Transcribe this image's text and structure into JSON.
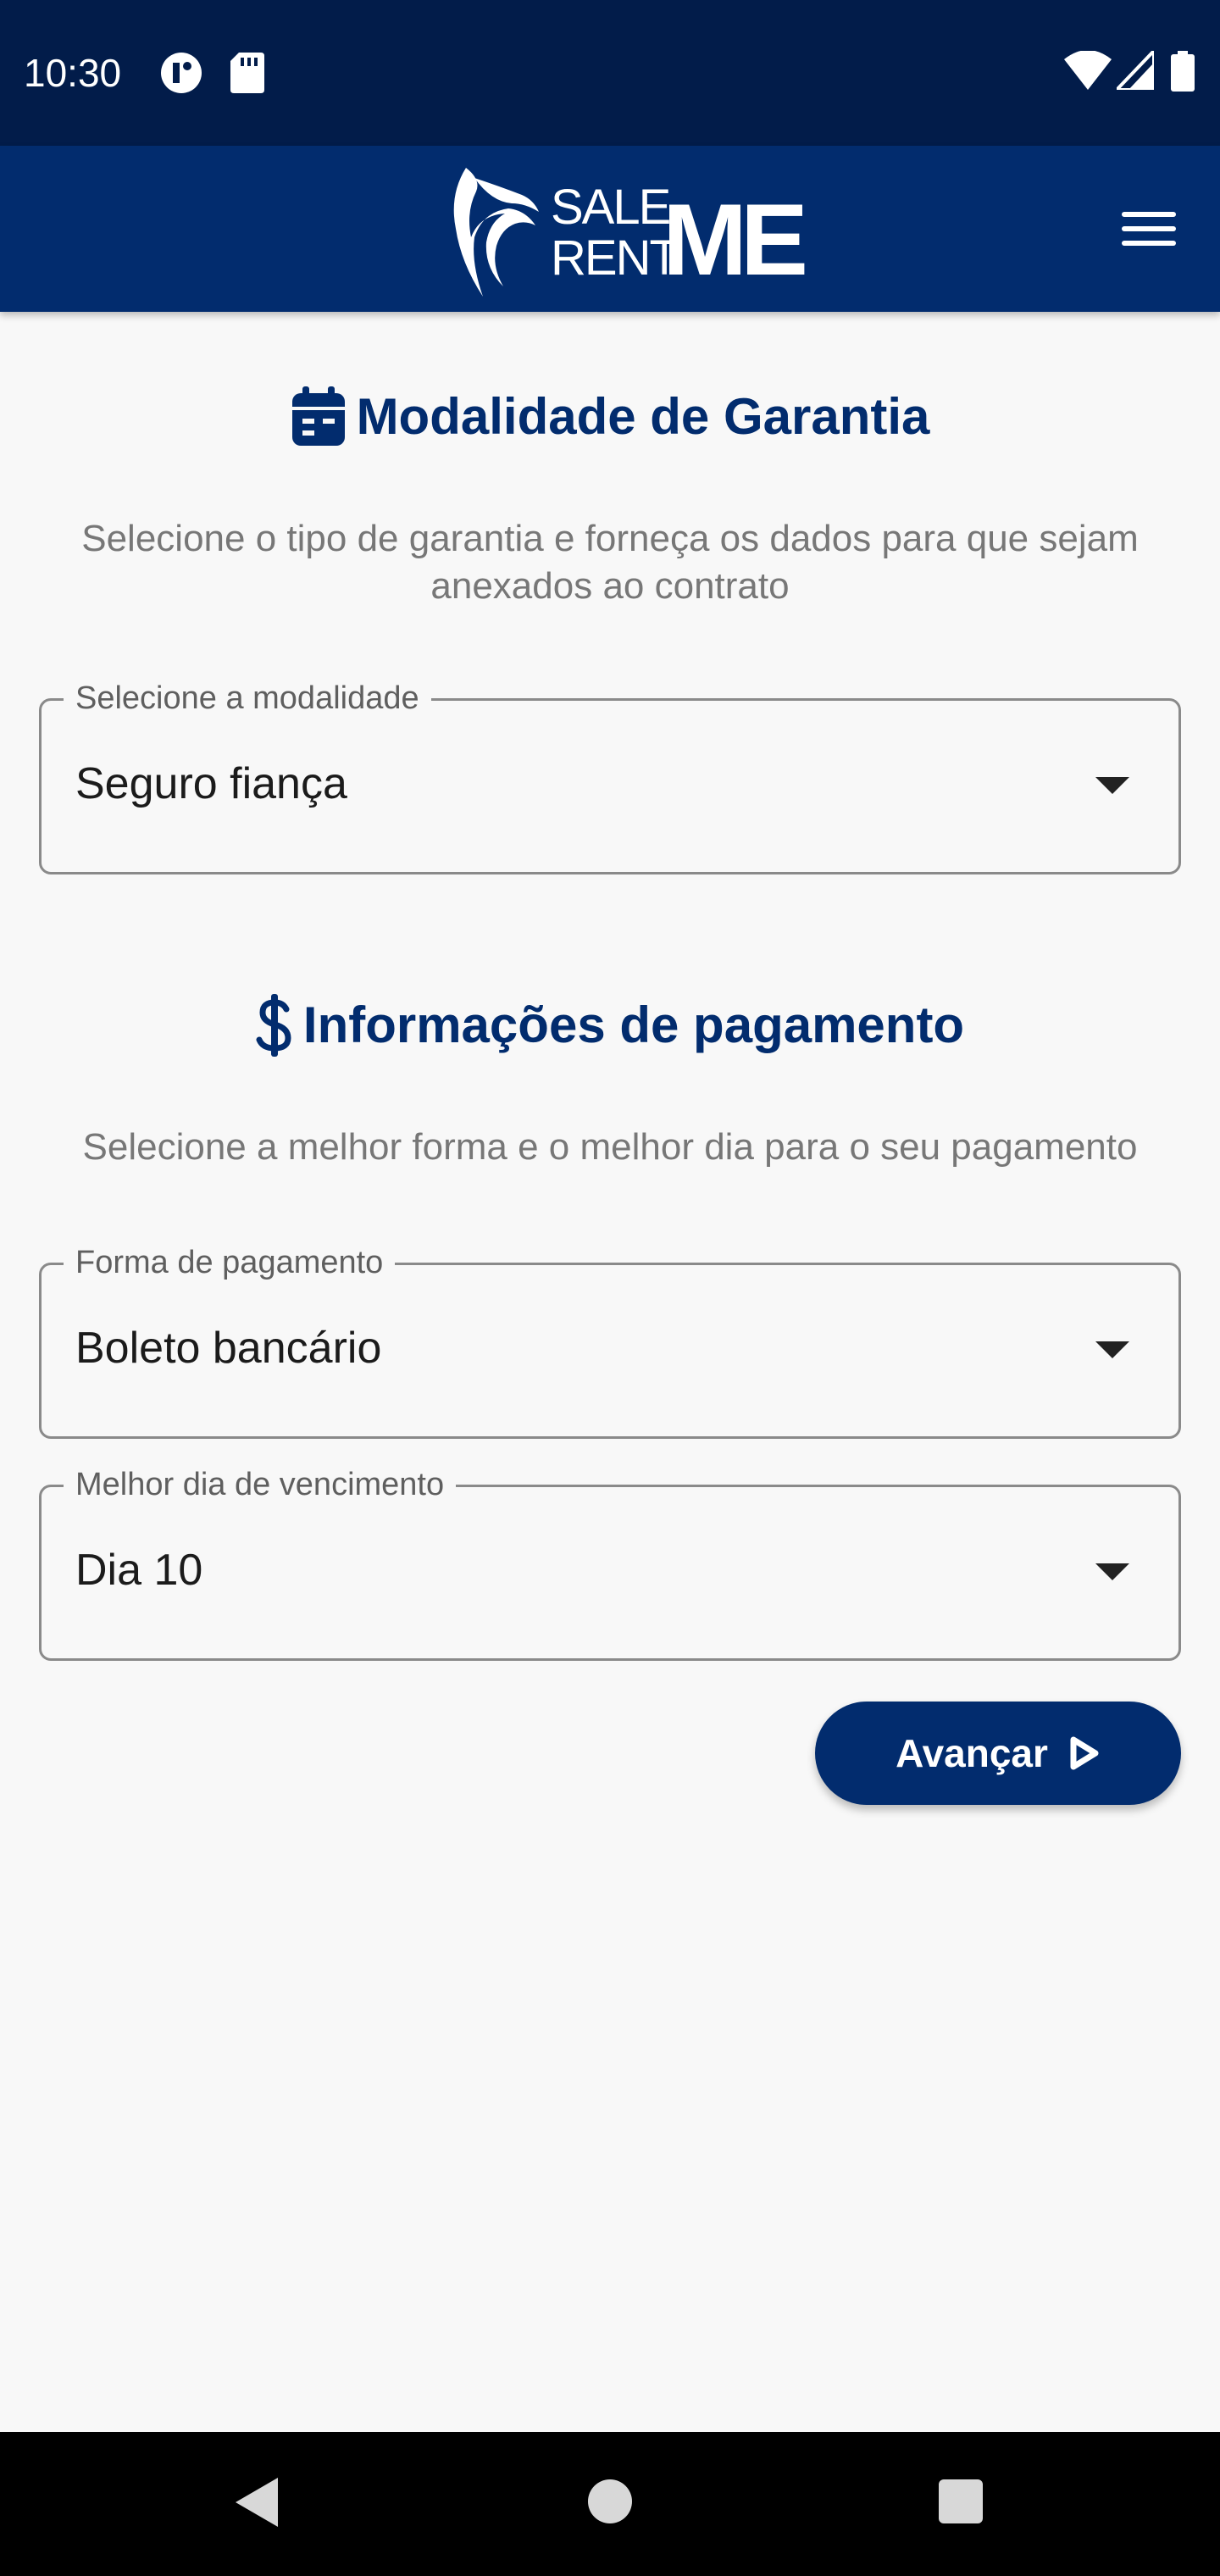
{
  "status_bar": {
    "time": "10:30",
    "icons": [
      "data-saver-icon",
      "sd-card-icon",
      "wifi-icon",
      "signal-icon",
      "battery-icon"
    ]
  },
  "app_bar": {
    "logo_line1": "SALE",
    "logo_line2": "RENT",
    "logo_mark": "ME",
    "menu_icon": "hamburger-menu-icon"
  },
  "guarantee": {
    "icon": "calendar-icon",
    "title": "Modalidade de Garantia",
    "subtitle": "Selecione o tipo de garantia e forneça os dados para que sejam anexados ao contrato",
    "field_label": "Selecione a modalidade",
    "field_value": "Seguro fiança"
  },
  "payment": {
    "icon": "dollar-icon",
    "title": "Informações de pagamento",
    "subtitle": "Selecione a melhor forma e o melhor dia para o seu pagamento",
    "method_label": "Forma de pagamento",
    "method_value": "Boleto bancário",
    "day_label": "Melhor dia de vencimento",
    "day_value": "Dia 10"
  },
  "actions": {
    "advance_label": "Avançar",
    "advance_icon": "play-outline-icon"
  },
  "colors": {
    "primary": "#022c6e",
    "status_bar": "#021c4a",
    "background": "#f8f8f8"
  }
}
